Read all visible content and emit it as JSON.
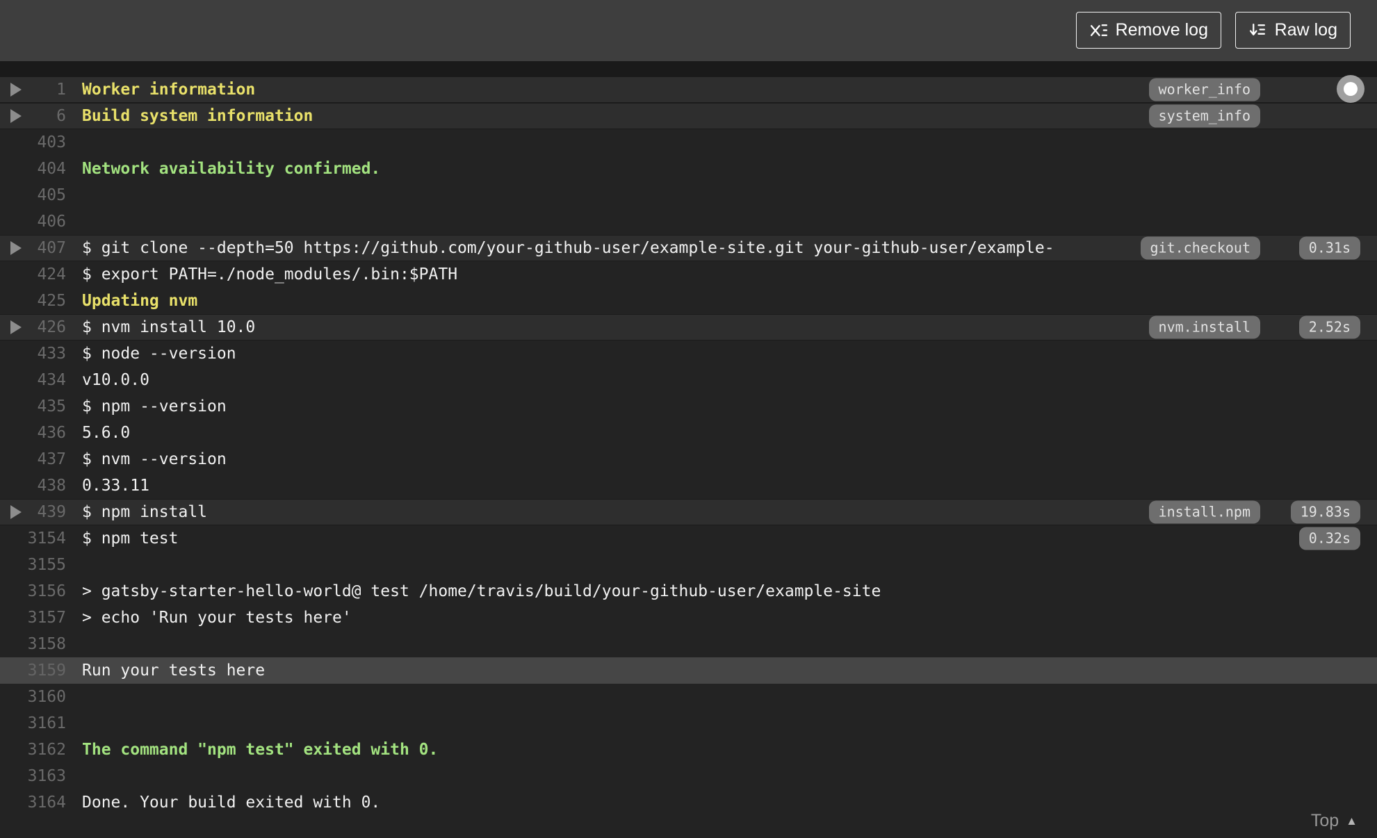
{
  "header": {
    "remove_log_label": "Remove log",
    "raw_log_label": "Raw log",
    "remove_log_icon": "x-list-icon",
    "raw_log_icon": "arrow-down-list-icon"
  },
  "footer": {
    "top_label": "Top",
    "top_icon": "caret-up-icon"
  },
  "colors": {
    "header_bg": "#3e3e3e",
    "log_bg": "#232323",
    "fold_row_bg": "#2e2e2e",
    "highlight_row_bg": "#464646",
    "accent_yellow": "#e9e16a",
    "accent_green": "#a3e380",
    "badge_bg": "#6e6e6e"
  },
  "log": {
    "rows": [
      {
        "num": "1",
        "text": "Worker information",
        "style": "yellow",
        "fold": true,
        "badge": "worker_info"
      },
      {
        "num": "6",
        "text": "Build system information",
        "style": "yellow",
        "fold": true,
        "badge": "system_info"
      },
      {
        "num": "403",
        "text": "",
        "style": "plain"
      },
      {
        "num": "404",
        "text": "Network availability confirmed.",
        "style": "green"
      },
      {
        "num": "405",
        "text": "",
        "style": "plain"
      },
      {
        "num": "406",
        "text": "",
        "style": "plain"
      },
      {
        "num": "407",
        "text": "$ git clone --depth=50 https://github.com/your-github-user/example-site.git your-github-user/example-",
        "style": "plain",
        "fold": true,
        "badge": "git.checkout",
        "time": "0.31s"
      },
      {
        "num": "424",
        "text": "$ export PATH=./node_modules/.bin:$PATH",
        "style": "plain"
      },
      {
        "num": "425",
        "text": "Updating nvm",
        "style": "yellow"
      },
      {
        "num": "426",
        "text": "$ nvm install 10.0",
        "style": "plain",
        "fold": true,
        "badge": "nvm.install",
        "time": "2.52s"
      },
      {
        "num": "433",
        "text": "$ node --version",
        "style": "plain"
      },
      {
        "num": "434",
        "text": "v10.0.0",
        "style": "plain"
      },
      {
        "num": "435",
        "text": "$ npm --version",
        "style": "plain"
      },
      {
        "num": "436",
        "text": "5.6.0",
        "style": "plain"
      },
      {
        "num": "437",
        "text": "$ nvm --version",
        "style": "plain"
      },
      {
        "num": "438",
        "text": "0.33.11",
        "style": "plain"
      },
      {
        "num": "439",
        "text": "$ npm install",
        "style": "plain",
        "fold": true,
        "badge": "install.npm",
        "time": "19.83s"
      },
      {
        "num": "3154",
        "text": "$ npm test",
        "style": "plain",
        "time": "0.32s"
      },
      {
        "num": "3155",
        "text": "",
        "style": "plain"
      },
      {
        "num": "3156",
        "text": "> gatsby-starter-hello-world@ test /home/travis/build/your-github-user/example-site",
        "style": "plain"
      },
      {
        "num": "3157",
        "text": "> echo 'Run your tests here'",
        "style": "plain"
      },
      {
        "num": "3158",
        "text": "",
        "style": "plain"
      },
      {
        "num": "3159",
        "text": "Run your tests here",
        "style": "plain",
        "highlight": true
      },
      {
        "num": "3160",
        "text": "",
        "style": "plain"
      },
      {
        "num": "3161",
        "text": "",
        "style": "plain"
      },
      {
        "num": "3162",
        "text": "The command \"npm test\" exited with 0.",
        "style": "green"
      },
      {
        "num": "3163",
        "text": "",
        "style": "plain"
      },
      {
        "num": "3164",
        "text": "Done. Your build exited with 0.",
        "style": "plain"
      }
    ]
  }
}
